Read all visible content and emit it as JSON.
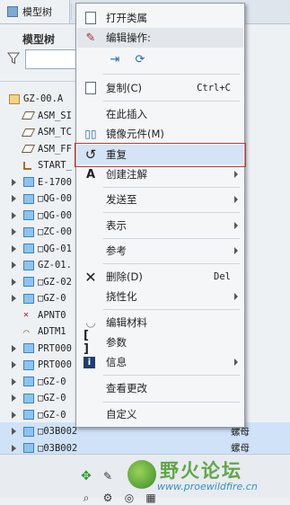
{
  "tab": {
    "label": "模型树"
  },
  "tree": {
    "title": "模型树",
    "rows": [
      {
        "label": "GZ-00.A",
        "extra": "",
        "icon": "asm-icon",
        "arrow": false
      },
      {
        "label": "ASM_SI",
        "extra": "",
        "icon": "plane-icon",
        "arrow": false
      },
      {
        "label": "ASM_TC",
        "extra": "",
        "icon": "plane-icon",
        "arrow": false
      },
      {
        "label": "ASM_FF",
        "extra": "",
        "icon": "plane-icon",
        "arrow": false
      },
      {
        "label": "START_",
        "extra": "",
        "icon": "csys-icon",
        "arrow": false
      },
      {
        "label": "E-1700",
        "extra": "",
        "icon": "part-icon",
        "arrow": true
      },
      {
        "label": "□QG-00",
        "extra": "",
        "icon": "part-icon",
        "arrow": true
      },
      {
        "label": "□QG-00",
        "extra": "",
        "icon": "part-icon",
        "arrow": true
      },
      {
        "label": "□ZC-00",
        "extra": "",
        "icon": "part-icon",
        "arrow": true
      },
      {
        "label": "□QG-01",
        "extra": "",
        "icon": "part-icon",
        "arrow": true
      },
      {
        "label": "GZ-01.",
        "extra": "",
        "icon": "part-icon",
        "arrow": true
      },
      {
        "label": "□GZ-02",
        "extra": "",
        "icon": "part-icon",
        "arrow": true
      },
      {
        "label": "□GZ-0",
        "extra": "",
        "icon": "part-icon",
        "arrow": true
      },
      {
        "label": "APNT0",
        "extra": "",
        "icon": "x-icon",
        "arrow": false
      },
      {
        "label": "ADTM1",
        "extra": "",
        "icon": "curve-icon",
        "arrow": false
      },
      {
        "label": "PRT000",
        "extra": "",
        "icon": "part-icon",
        "arrow": true
      },
      {
        "label": "PRT000",
        "extra": "",
        "icon": "part-icon",
        "arrow": true
      },
      {
        "label": "□GZ-0",
        "extra": "",
        "icon": "part-icon",
        "arrow": true
      },
      {
        "label": "□GZ-0",
        "extra": "",
        "icon": "part-icon",
        "arrow": true
      },
      {
        "label": "□GZ-0",
        "extra": "",
        "icon": "part-icon",
        "arrow": true
      },
      {
        "label": "□03B002",
        "extra": "螺母",
        "icon": "part-icon",
        "arrow": true
      },
      {
        "label": "□03B002",
        "extra": "螺母",
        "icon": "part-icon",
        "arrow": true
      }
    ]
  },
  "menu": {
    "open_category": "打开类属",
    "edit_ops_header": "编辑操作:",
    "copy": {
      "label": "复制(C)",
      "shortcut": "Ctrl+C"
    },
    "insert_here": "在此插入",
    "mirror": "镜像元件(M)",
    "repeat": "重复",
    "create_note": "创建注解",
    "send_to": "发送至",
    "show": "表示",
    "reference": "参考",
    "delete": {
      "label": "删除(D)",
      "shortcut": "Del"
    },
    "flexible": "挠性化",
    "edit_material": "编辑材料",
    "parameters": "参数",
    "info": "信息",
    "view_changes": "查看更改",
    "customize": "自定义"
  },
  "watermark": {
    "text": "野火论坛",
    "url": "www.proewildfire.cn"
  },
  "colors": {
    "highlight_border": "#d8302a",
    "menu_hover": "#d4e4f5"
  }
}
